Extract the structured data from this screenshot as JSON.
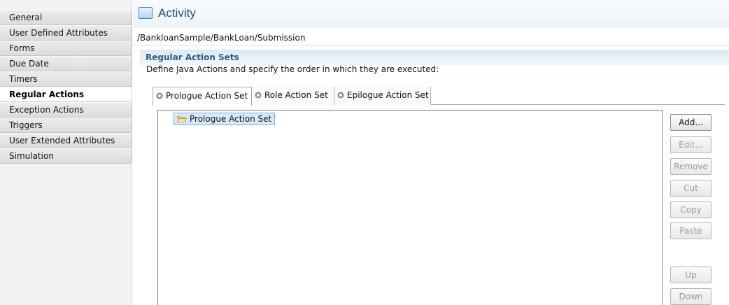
{
  "sidebar": {
    "items": [
      {
        "label": "General"
      },
      {
        "label": "User Defined Attributes"
      },
      {
        "label": "Forms"
      },
      {
        "label": "Due Date"
      },
      {
        "label": "Timers"
      },
      {
        "label": "Regular Actions",
        "active": true
      },
      {
        "label": "Exception Actions"
      },
      {
        "label": "Triggers"
      },
      {
        "label": "User Extended Attributes"
      },
      {
        "label": "Simulation"
      }
    ]
  },
  "header": {
    "title": "Activity",
    "path": "/BankloanSample/BankLoan/Submission"
  },
  "section": {
    "title": "Regular Action Sets",
    "description": "Define Java Actions and specify the order in which they are executed:"
  },
  "tabs": [
    {
      "label": "Prologue Action Set",
      "selected": true
    },
    {
      "label": "Role Action Set"
    },
    {
      "label": "Epilogue Action Set"
    }
  ],
  "tree": {
    "nodes": [
      {
        "label": "Prologue Action Set"
      }
    ]
  },
  "buttons": {
    "add": "Add...",
    "edit": "Edit...",
    "remove": "Remove",
    "cut": "Cut",
    "copy": "Copy",
    "paste": "Paste",
    "up": "Up",
    "down": "Down"
  },
  "colors": {
    "accent": "#2a5b8f",
    "selection": "#d7e8f8"
  }
}
